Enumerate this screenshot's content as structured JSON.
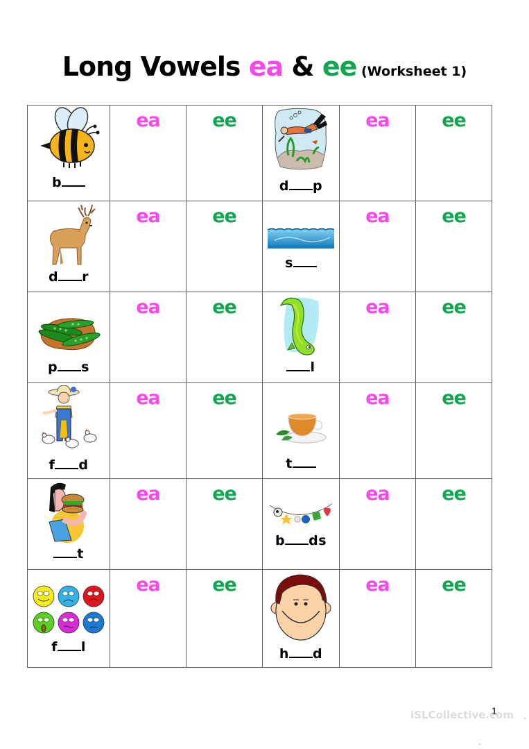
{
  "title": {
    "main": "Long Vowels ",
    "vowel_a": "ea",
    "amp": " & ",
    "vowel_b": "ee",
    "subtitle": " (Worksheet 1)"
  },
  "colors": {
    "ea": "#f549e8",
    "ee": "#13a551",
    "grid": "#5c5c5c"
  },
  "options": {
    "ea": "ea",
    "ee": "ee"
  },
  "rows": [
    {
      "left": {
        "picture": "bee-icon",
        "prefix": "b",
        "suffix": ""
      },
      "right": {
        "picture": "diver-icon",
        "prefix": "d",
        "suffix": "p"
      }
    },
    {
      "left": {
        "picture": "deer-icon",
        "prefix": "d",
        "suffix": "r"
      },
      "right": {
        "picture": "sea-icon",
        "prefix": "s",
        "suffix": ""
      }
    },
    {
      "left": {
        "picture": "peas-icon",
        "prefix": "p",
        "suffix": "s"
      },
      "right": {
        "picture": "eel-icon",
        "prefix": "",
        "suffix": "l"
      }
    },
    {
      "left": {
        "picture": "farmer-feeding-chickens-icon",
        "prefix": "f",
        "suffix": "d"
      },
      "right": {
        "picture": "tea-cup-icon",
        "prefix": "t",
        "suffix": ""
      }
    },
    {
      "left": {
        "picture": "man-eating-burger-icon",
        "prefix": "",
        "suffix": "t"
      },
      "right": {
        "picture": "beads-icon",
        "prefix": "b",
        "suffix": "ds"
      }
    },
    {
      "left": {
        "picture": "feelings-faces-icon",
        "prefix": "f",
        "suffix": "l"
      },
      "right": {
        "picture": "head-icon",
        "prefix": "h",
        "suffix": "d"
      }
    }
  ],
  "footer": {
    "watermark": "iSLCollective.com",
    "page_number": "1"
  }
}
